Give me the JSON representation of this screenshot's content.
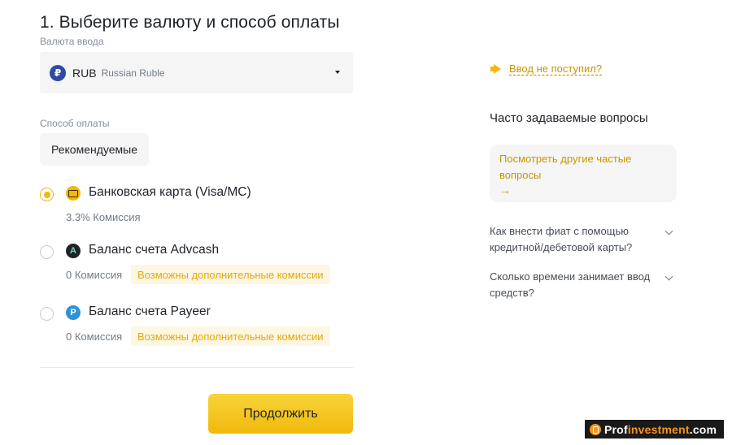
{
  "step_title": "1. Выберите валюту и способ оплаты",
  "currency": {
    "label": "Валюта ввода",
    "icon_symbol": "₽",
    "code": "RUB",
    "name": "Russian Ruble"
  },
  "payment": {
    "label": "Способ оплаты",
    "tab_label": "Рекомендуемые",
    "methods": [
      {
        "name": "Банковская карта (Visa/MC)",
        "fee": "3.3% Комиссия",
        "note": "",
        "icon": "card-icon",
        "selected": true
      },
      {
        "name": "Баланс счета Advcash",
        "fee": "0 Комиссия",
        "note": "Возможны дополнительные комиссии",
        "icon": "advcash-icon",
        "icon_symbol": "A",
        "selected": false
      },
      {
        "name": "Баланс счета Payeer",
        "fee": "0 Комиссия",
        "note": "Возможны дополнительные комиссии",
        "icon": "payeer-icon",
        "icon_symbol": "P",
        "selected": false
      }
    ]
  },
  "continue_label": "Продолжить",
  "sidebar": {
    "not_received": "Ввод не поступил?",
    "faq_title": "Часто задаваемые вопросы",
    "faq_more": "Посмотреть другие частые вопросы",
    "faq_more_arrow": "→",
    "questions": [
      "Как внести фиат с помощью кредитной/дебетовой карты?",
      "Сколько времени занимает ввод средств?"
    ]
  },
  "watermark": {
    "part1": "Prof",
    "part2": "investment",
    "part3": ".com"
  },
  "colors": {
    "accent": "#f0b90b",
    "link": "#c99400",
    "note_bg": "#fdf6e3"
  }
}
